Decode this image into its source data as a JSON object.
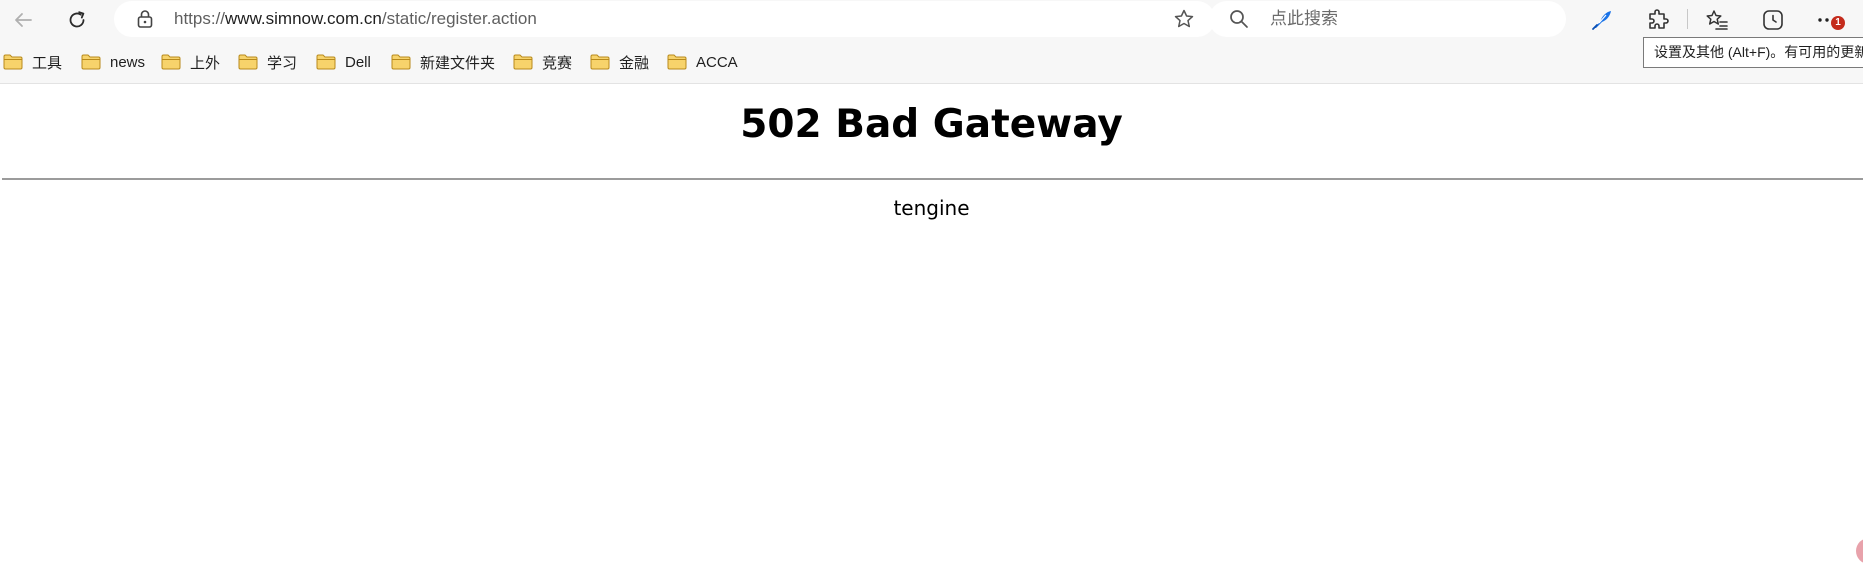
{
  "browser": {
    "address": {
      "scheme": "https://",
      "host": "www.simnow.com.cn",
      "path": "/static/register.action"
    },
    "search": {
      "placeholder": "点此搜索"
    },
    "menu_badge": "1",
    "tooltip": "设置及其他 (Alt+F)。有可用的更新"
  },
  "bookmarks": [
    {
      "label": "工具"
    },
    {
      "label": "news"
    },
    {
      "label": "上外"
    },
    {
      "label": "学习"
    },
    {
      "label": "Dell"
    },
    {
      "label": "新建文件夹"
    },
    {
      "label": "竞赛"
    },
    {
      "label": "金融"
    },
    {
      "label": "ACCA"
    }
  ],
  "page": {
    "heading": "502 Bad Gateway",
    "server": "tengine"
  },
  "colors": {
    "toolbar_bg": "#f7f7f7",
    "folder_fill": "#f7d36b",
    "folder_stroke": "#b88a1b",
    "accent_blue": "#1a73e8",
    "badge_red": "#c42b1c"
  }
}
